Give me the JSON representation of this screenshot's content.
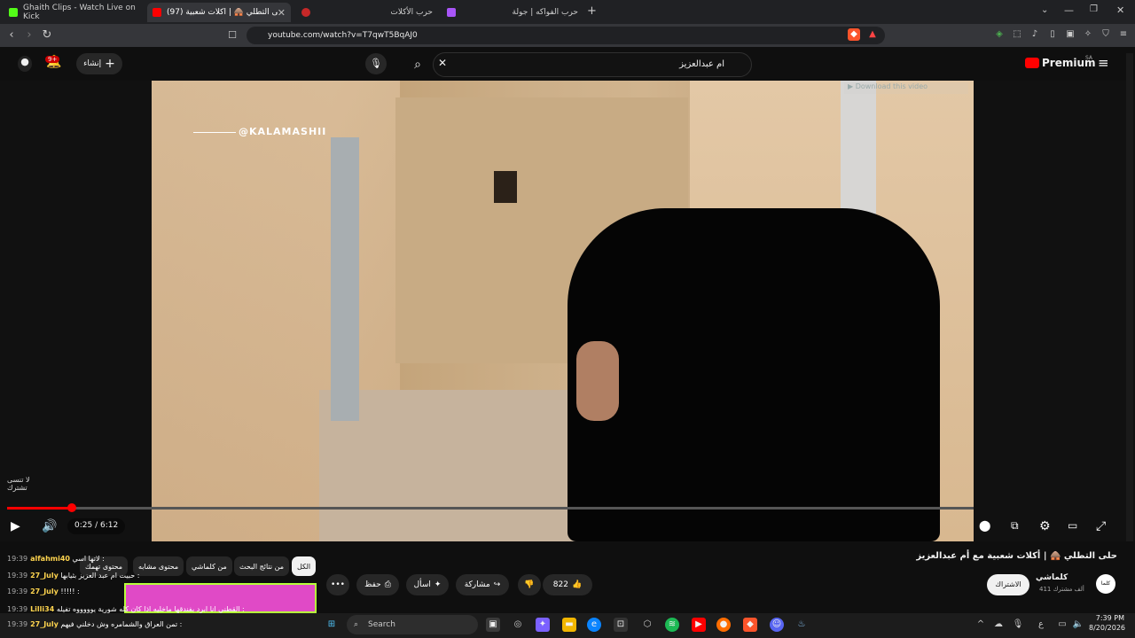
{
  "tabs": [
    {
      "title": "Ghaith Clips - Watch Live on Kick",
      "active": false
    },
    {
      "title": "(97) حلى التطلي 🛖 | أكلات شعبية",
      "active": true
    },
    {
      "title": "حرب الأكلات",
      "active": false
    },
    {
      "title": "حرب الفواكه | جولة",
      "active": false
    }
  ],
  "address": {
    "url": "youtube.com/watch?v=T7qwT5BqAJ0"
  },
  "header": {
    "logo": "Premium",
    "logo_region": "SA",
    "create_label": "إنشاء",
    "notif_count": "9+",
    "search_value": "ام عبدالعزيز"
  },
  "video": {
    "watermark": "@KALAMASHII",
    "download_label": "Download this video",
    "corner_text": "لا تنسى تشترك",
    "time": "0:25 / 6:12",
    "progress": 0.067
  },
  "below": {
    "title": "حلى التطلي 🛖 | أكلات شعبية مع أم عبدالعزيز",
    "channel": "كلماشي",
    "subscribers": "411 ألف مشترك",
    "subscribe_label": "الاشتراك",
    "likes": "822",
    "share_label": "مشاركة",
    "ask_label": "اسأل",
    "save_label": "حفظ",
    "chips": [
      "الكل",
      "من نتائج البحث",
      "من كلماشي",
      "محتوى مشابه",
      "محتوى تهمك"
    ]
  },
  "chat": [
    {
      "time": "19:39",
      "user": "alfahmi40",
      "msg": "لاتها اسي :"
    },
    {
      "time": "19:39",
      "user": "27_July",
      "msg": "حبيت ام عبد العزيز بثيابها :"
    },
    {
      "time": "19:39",
      "user": "27_July",
      "msg": "!!!!! :"
    },
    {
      "time": "19:39",
      "user": "Lilli34",
      "msg": "القطني انا ابرد بفندقها ماخليه اذا كان كله شورية يوووووه تفيله :"
    },
    {
      "time": "19:39",
      "user": "27_July",
      "msg": "تمن العراق والشمامره وش دخلني فيهم :"
    }
  ],
  "taskbar": {
    "search": "Search",
    "time": "7:39 PM",
    "date": "8/20/2026"
  },
  "colors": {
    "accent": "#ff0000",
    "bg": "#0f0f0f"
  }
}
